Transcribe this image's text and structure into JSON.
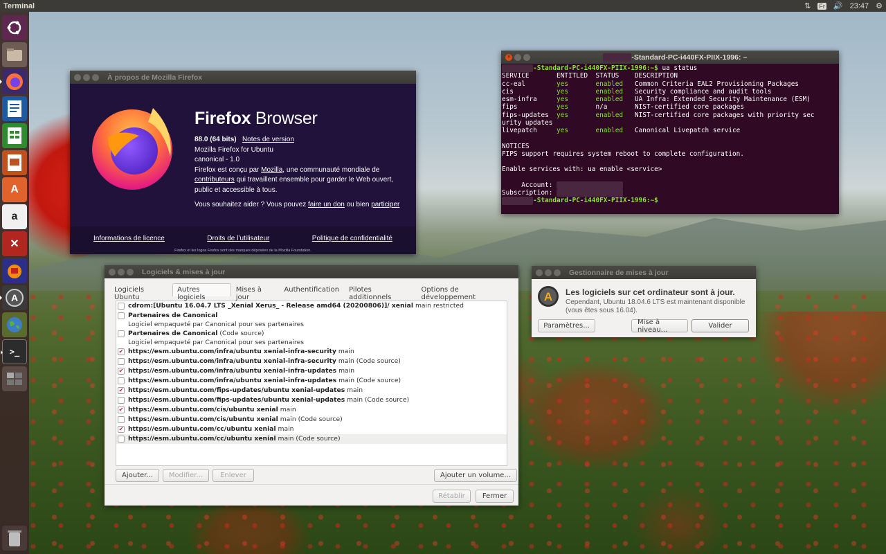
{
  "topbar": {
    "app": "Terminal",
    "keyboard": "Fr",
    "time": "23:47"
  },
  "launcher": [
    "dash-icon",
    "files-icon",
    "firefox-icon",
    "writer-icon",
    "calc-icon",
    "impress-icon",
    "software-icon",
    "amazon-icon",
    "settings-icon",
    "audacity-icon",
    "software-updater-icon",
    "globe-icon",
    "terminal-icon",
    "workspaces-icon",
    "trash-icon"
  ],
  "firefox": {
    "title": "À propos de Mozilla Firefox",
    "brand_bold": "Firefox",
    "brand_rest": " Browser",
    "version": "88.0 (64 bits)",
    "release_notes": "Notes de version",
    "line2": "Mozilla Firefox for Ubuntu",
    "line3": "canonical - 1.0",
    "desc_a": "Firefox est conçu par ",
    "desc_mozilla": "Mozilla",
    "desc_b": ", une communauté mondiale de ",
    "desc_contrib": "contributeurs",
    "desc_c": " qui travaillent ensemble pour garder le Web ouvert, public et accessible à tous.",
    "help_a": "Vous souhaitez aider ? Vous pouvez ",
    "help_don": "faire un don",
    "help_b": " ou bien ",
    "help_part": "participer",
    "license": "Informations de licence",
    "rights": "Droits de l’utilisateur",
    "privacy": "Politique de confidentialité",
    "trademark": "Firefox et les logos Firefox sont des marques déposées de la Mozilla Foundation."
  },
  "terminal": {
    "title_suffix": "-Standard-PC-i440FX-PIIX-1996: ~",
    "prompt_host": "-Standard-PC-i440FX-PIIX-1996",
    "command": "ua status",
    "header": "SERVICE       ENTITLED  STATUS    DESCRIPTION",
    "rows": [
      [
        "cc-eal",
        "yes",
        "enabled",
        "Common Criteria EAL2 Provisioning Packages"
      ],
      [
        "cis",
        "yes",
        "enabled",
        "Security compliance and audit tools"
      ],
      [
        "esm-infra",
        "yes",
        "enabled",
        "UA Infra: Extended Security Maintenance (ESM)"
      ],
      [
        "fips",
        "yes",
        "n/a",
        "NIST-certified core packages"
      ],
      [
        "fips-updates",
        "yes",
        "enabled",
        "NIST-certified core packages with priority sec"
      ],
      [
        "livepatch",
        "yes",
        "enabled",
        "Canonical Livepatch service"
      ]
    ],
    "wrap": "urity updates",
    "notices": "NOTICES",
    "notice_text": "FIPS support requires system reboot to complete configuration.",
    "enable": "Enable services with: ua enable <service>",
    "account": "     Account:",
    "subscription": "Subscription:"
  },
  "software": {
    "title": "Logiciels & mises à jour",
    "tabs": [
      "Logiciels Ubuntu",
      "Autres logiciels",
      "Mises à jour",
      "Authentification",
      "Pilotes additionnels",
      "Options de développement"
    ],
    "rows": [
      {
        "checked": false,
        "bold": "cdrom:[Ubuntu 16.04.7 LTS _Xenial Xerus_ - Release amd64 (20200806)]/ xenial",
        "rest": " main restricted"
      },
      {
        "checked": false,
        "bold": "Partenaires de Canonical",
        "rest": "",
        "sub": "Logiciel empaqueté par Canonical pour ses partenaires"
      },
      {
        "checked": false,
        "bold": "Partenaires de Canonical",
        "rest": " (Code source)",
        "sub": "Logiciel empaqueté par Canonical pour ses partenaires"
      },
      {
        "checked": true,
        "bold": "https://esm.ubuntu.com/infra/ubuntu xenial-infra-security",
        "rest": " main"
      },
      {
        "checked": false,
        "bold": "https://esm.ubuntu.com/infra/ubuntu xenial-infra-security",
        "rest": " main (Code source)"
      },
      {
        "checked": true,
        "bold": "https://esm.ubuntu.com/infra/ubuntu xenial-infra-updates",
        "rest": " main"
      },
      {
        "checked": false,
        "bold": "https://esm.ubuntu.com/infra/ubuntu xenial-infra-updates",
        "rest": " main (Code source)"
      },
      {
        "checked": true,
        "bold": "https://esm.ubuntu.com/fips-updates/ubuntu xenial-updates",
        "rest": " main"
      },
      {
        "checked": false,
        "bold": "https://esm.ubuntu.com/fips-updates/ubuntu xenial-updates",
        "rest": " main (Code source)"
      },
      {
        "checked": true,
        "bold": "https://esm.ubuntu.com/cis/ubuntu xenial",
        "rest": " main"
      },
      {
        "checked": false,
        "bold": "https://esm.ubuntu.com/cis/ubuntu xenial",
        "rest": " main (Code source)"
      },
      {
        "checked": true,
        "bold": "https://esm.ubuntu.com/cc/ubuntu xenial",
        "rest": " main"
      },
      {
        "checked": false,
        "bold": "https://esm.ubuntu.com/cc/ubuntu xenial",
        "rest": " main (Code source)"
      }
    ],
    "add": "Ajouter...",
    "modify": "Modifier...",
    "remove": "Enlever",
    "add_volume": "Ajouter un volume...",
    "revert": "Rétablir",
    "close": "Fermer"
  },
  "updater": {
    "title": "Gestionnaire de mises à jour",
    "heading": "Les logiciels sur cet ordinateur sont à jour.",
    "sub1": "Cependant, Ubuntu 18.04.6 LTS est maintenant disponible",
    "sub2": "(vous êtes sous 16.04).",
    "settings": "Paramètres...",
    "upgrade": "Mise à niveau...",
    "ok": "Valider"
  }
}
